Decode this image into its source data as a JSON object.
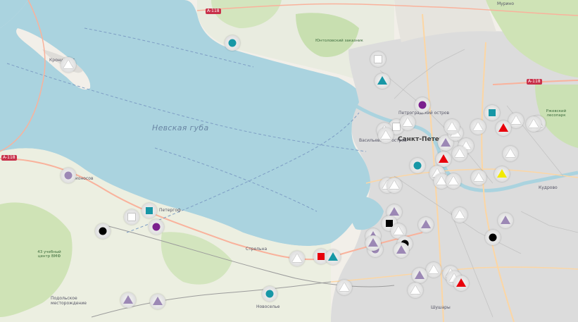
{
  "map": {
    "labels": {
      "gulf": "Невская губа",
      "city": "Санкт-Петер",
      "kronshtadt": "Кронштадт",
      "petrogradsky": "Петроградский остров",
      "vasilievsky": "Васильевский остров",
      "peterhof": "Петергоф",
      "strelna": "Стрельна",
      "novoselye": "Новоселье",
      "kudrovo": "Кудрово",
      "shushary": "Шушары",
      "murino": "Мурино",
      "yuntolovsky": "Юнтоловский заказник",
      "lomonosov": "Ломоносов",
      "training_center": "43 учебный центр ВМФ",
      "podolskoe": "Подольское месторождение",
      "park": "Ржевский лесопарк"
    },
    "roads": [
      "A-118",
      "A-118",
      "A-118"
    ],
    "colors": {
      "water": "#aad3df",
      "land": "#f2efe9",
      "green": "#c8dfb0",
      "urban": "#dddddd",
      "red": "#e8000b",
      "teal": "#1797a6",
      "purple": "#7b1f8e",
      "lavender": "#9c88b5",
      "black": "#000000",
      "yellow": "#f2ea00",
      "white": "#ffffff"
    },
    "markers": [
      {
        "symbol": "triangle",
        "color": "white"
      },
      {
        "symbol": "circle",
        "color": "teal"
      },
      {
        "symbol": "square",
        "color": "white"
      },
      {
        "symbol": "triangle",
        "color": "teal"
      },
      {
        "symbol": "circle",
        "color": "purple"
      },
      {
        "symbol": "square",
        "color": "teal"
      },
      {
        "symbol": "triangle",
        "color": "white"
      },
      {
        "symbol": "triangle",
        "color": "red"
      },
      {
        "symbol": "triangle",
        "color": "white"
      },
      {
        "symbol": "triangle",
        "color": "white"
      },
      {
        "symbol": "square",
        "color": "white"
      },
      {
        "symbol": "triangle",
        "color": "white"
      },
      {
        "symbol": "triangle",
        "color": "white"
      },
      {
        "symbol": "triangle",
        "color": "white"
      },
      {
        "symbol": "triangle",
        "color": "lavender"
      },
      {
        "symbol": "triangle",
        "color": "white"
      },
      {
        "symbol": "triangle",
        "color": "white"
      },
      {
        "symbol": "triangle",
        "color": "red"
      },
      {
        "symbol": "triangle",
        "color": "white"
      },
      {
        "symbol": "triangle",
        "color": "white"
      },
      {
        "symbol": "circle",
        "color": "teal"
      },
      {
        "symbol": "triangle",
        "color": "white"
      },
      {
        "symbol": "triangle",
        "color": "white"
      },
      {
        "symbol": "triangle",
        "color": "white"
      },
      {
        "symbol": "triangle",
        "color": "white"
      },
      {
        "symbol": "triangle",
        "color": "yellow"
      },
      {
        "symbol": "circle",
        "color": "lavender"
      },
      {
        "symbol": "square",
        "color": "white"
      },
      {
        "symbol": "square",
        "color": "teal"
      },
      {
        "symbol": "circle",
        "color": "purple"
      },
      {
        "symbol": "circle",
        "color": "black"
      },
      {
        "symbol": "triangle",
        "color": "lavender"
      },
      {
        "symbol": "square",
        "color": "black"
      },
      {
        "symbol": "triangle",
        "color": "lavender"
      },
      {
        "symbol": "triangle",
        "color": "white"
      },
      {
        "symbol": "triangle",
        "color": "lavender"
      },
      {
        "symbol": "triangle",
        "color": "white"
      },
      {
        "symbol": "circle",
        "color": "black"
      },
      {
        "symbol": "triangle",
        "color": "lavender"
      },
      {
        "symbol": "circle",
        "color": "lavender"
      },
      {
        "symbol": "triangle",
        "color": "lavender"
      },
      {
        "symbol": "triangle",
        "color": "white"
      },
      {
        "symbol": "square",
        "color": "red"
      },
      {
        "symbol": "triangle",
        "color": "teal"
      },
      {
        "symbol": "triangle",
        "color": "white"
      },
      {
        "symbol": "triangle",
        "color": "lavender"
      },
      {
        "symbol": "triangle",
        "color": "white"
      },
      {
        "symbol": "triangle",
        "color": "white"
      },
      {
        "symbol": "triangle",
        "color": "red"
      },
      {
        "symbol": "triangle",
        "color": "white"
      },
      {
        "symbol": "triangle",
        "color": "white"
      },
      {
        "symbol": "circle",
        "color": "teal"
      },
      {
        "symbol": "triangle",
        "color": "lavender"
      },
      {
        "symbol": "triangle",
        "color": "lavender"
      },
      {
        "symbol": "circle",
        "color": "black"
      },
      {
        "symbol": "triangle",
        "color": "lavender"
      },
      {
        "symbol": "triangle",
        "color": "white"
      },
      {
        "symbol": "triangle",
        "color": "white"
      },
      {
        "symbol": "triangle",
        "color": "white"
      },
      {
        "symbol": "triangle",
        "color": "white"
      }
    ]
  }
}
